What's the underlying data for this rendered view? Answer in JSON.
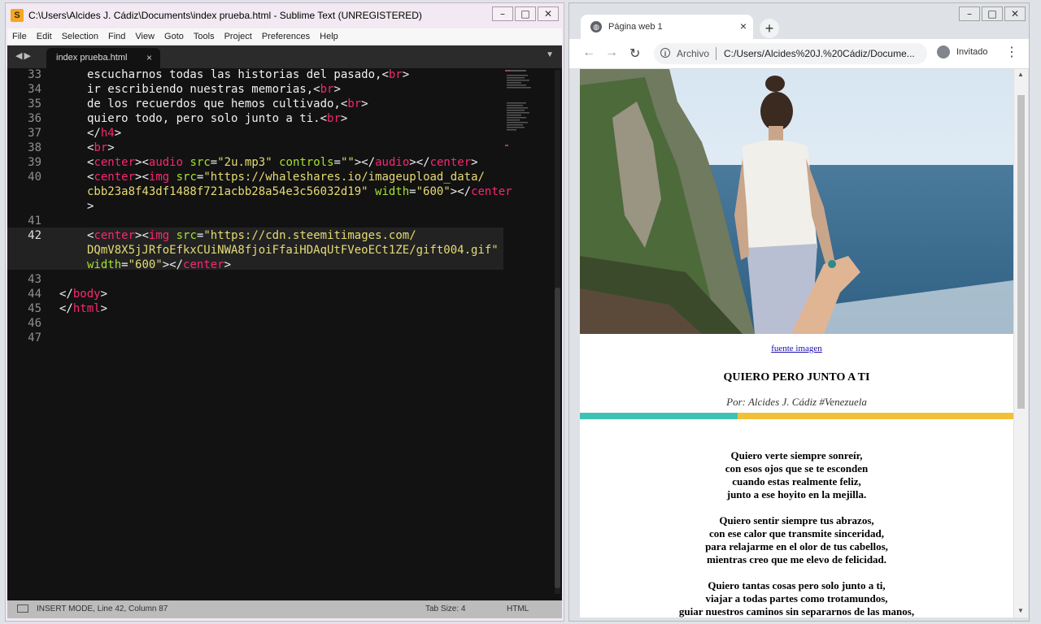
{
  "sublime": {
    "title": "C:\\Users\\Alcides J. Cádiz\\Documents\\index prueba.html - Sublime Text (UNREGISTERED)",
    "menu": [
      "File",
      "Edit",
      "Selection",
      "Find",
      "View",
      "Goto",
      "Tools",
      "Project",
      "Preferences",
      "Help"
    ],
    "tab_label": "index prueba.html",
    "line_numbers": [
      "33",
      "34",
      "35",
      "36",
      "37",
      "38",
      "39",
      "40",
      "",
      "41",
      "42",
      "",
      "",
      "43",
      "44",
      "45",
      "46",
      "47"
    ],
    "code": {
      "l33_text": "escucharnos todas las historias del pasado,",
      "l34_text": "ir escribiendo nuestras memorias,",
      "l35_text": "de los recuerdos que hemos cultivado,",
      "l36_text": "quiero todo, pero solo junto a ti.",
      "lt": "<",
      "gt": ">",
      "lts": "</",
      "br": "br",
      "h4": "h4",
      "center": "center",
      "audio": "audio",
      "img": "img",
      "body": "body",
      "html": "html",
      "src": "src",
      "controls": "controls",
      "width": "width",
      "eq": "=",
      "audio_src": "\"2u.mp3\"",
      "empty": "\"\"",
      "img1_src_a": "\"https://whaleshares.io/imageupload_data/",
      "img1_src_b": "cbb23a8f43df1488f721acbb28a54e3c56032d19\"",
      "w600": "\"600\"",
      "img2_src_a": "\"https://cdn.steemitimages.com/",
      "img2_src_b": "DQmV8X5jJRfoEfkxCUiNWA8fjoiFfaiHDAqUtFVeoECt1ZE/gift004.gif\""
    },
    "status": {
      "mode": "INSERT MODE, Line 42, Column 87",
      "tab_size": "Tab Size: 4",
      "syntax": "HTML"
    }
  },
  "chrome": {
    "tab_title": "Página web 1",
    "omnibox_chip": "Archivo",
    "url": "C:/Users/Alcides%20J.%20Cádiz/Docume...",
    "profile": "Invitado"
  },
  "page": {
    "photo_link": "fuente imagen",
    "title": "QUIERO PERO JUNTO A TI",
    "author": "Por: Alcides J. Cádiz #Venezuela",
    "stanzas": [
      [
        "Quiero verte siempre sonreír,",
        "con esos ojos que se te esconden",
        "cuando estas realmente feliz,",
        "junto a ese hoyito en la mejilla."
      ],
      [
        "Quiero sentir siempre tus abrazos,",
        "con ese calor que transmite sinceridad,",
        "para relajarme en el olor de tus cabellos,",
        "mientras creo que me elevo de felicidad."
      ],
      [
        "Quiero tantas cosas pero solo junto a ti,",
        "viajar a todas partes como trotamundos,",
        "guiar nuestros caminos sin separarnos de las manos,"
      ]
    ]
  },
  "colors": {
    "editor_bg": "#121212",
    "tag": "#f92672",
    "attr": "#a6e22e",
    "string": "#e6db74",
    "divider_teal": "#3fc1b4",
    "divider_yellow": "#f2c037"
  },
  "icons": [
    "sublime-logo-icon",
    "minimize-icon",
    "maximize-icon",
    "close-icon",
    "chevron-down-icon",
    "globe-icon",
    "plus-icon",
    "back-arrow-icon",
    "forward-arrow-icon",
    "reload-icon",
    "info-icon",
    "avatar-icon",
    "kebab-menu-icon"
  ]
}
